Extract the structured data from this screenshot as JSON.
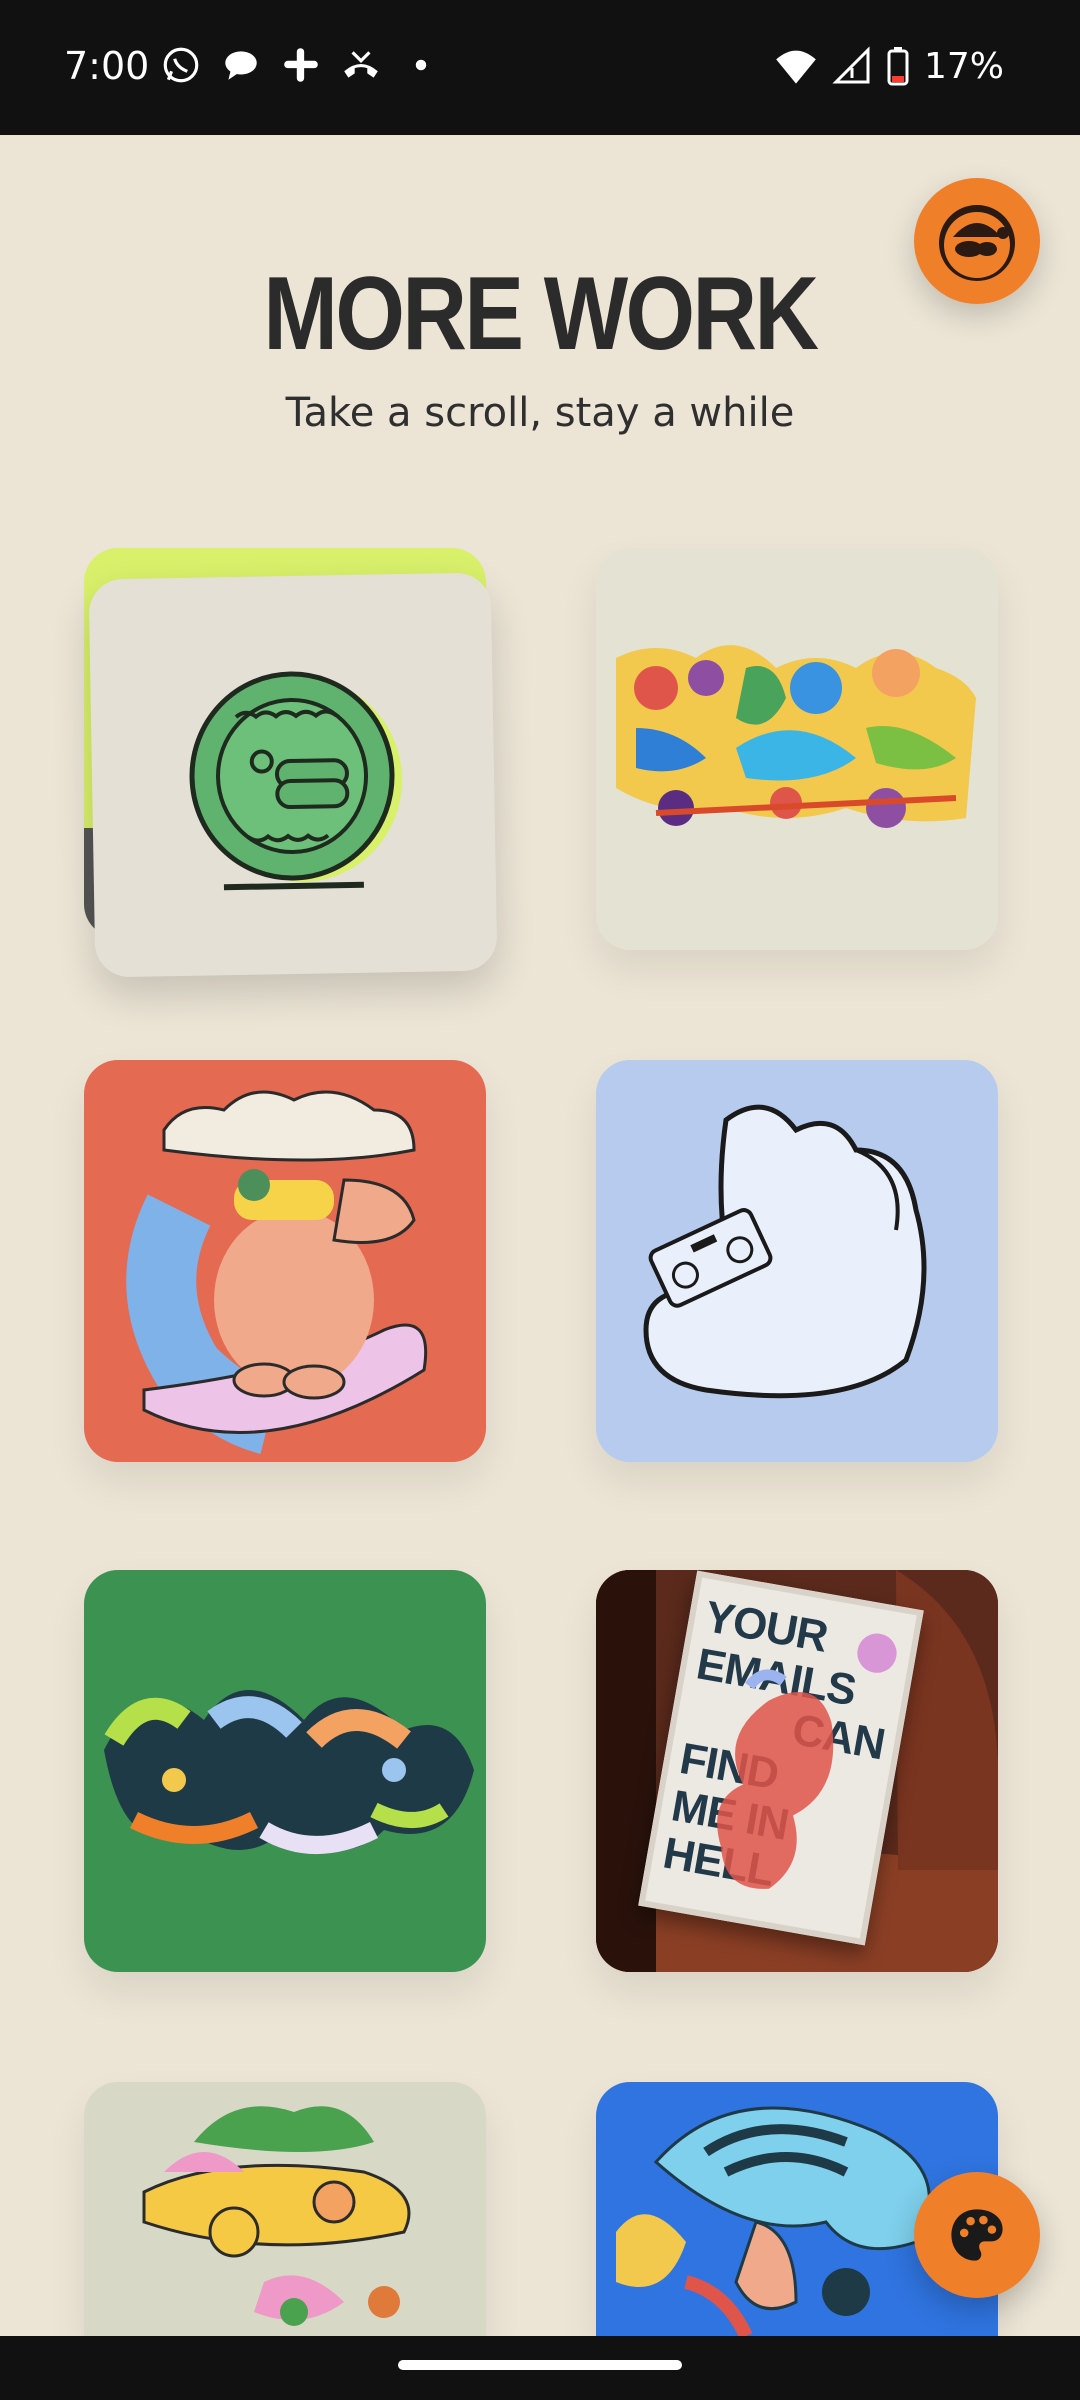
{
  "status_bar": {
    "time": "7:00",
    "battery": "17%",
    "notification_icons": [
      "whatsapp-icon",
      "chat-bubble-icon",
      "slack-icon",
      "missed-call-icon",
      "dot-icon"
    ],
    "system_icons": [
      "wifi-icon",
      "signal-icon",
      "battery-low-icon"
    ]
  },
  "header": {
    "title": "MORE WORK",
    "subtitle": "Take a scroll, stay a while"
  },
  "avatar": {
    "icon": "profile-avatar"
  },
  "fab": {
    "icon": "palette-icon"
  },
  "colors": {
    "background": "#ece5d6",
    "accent": "#f07f2a",
    "tile_red": "#e46a51",
    "tile_blue": "#b6cbee",
    "tile_green": "#3c9250",
    "tile_lime": "#d8f06a"
  },
  "poster": {
    "lines": [
      "YOUR",
      "EMAILS",
      "CAN",
      "FIND",
      "ME IN",
      "HELL"
    ]
  }
}
